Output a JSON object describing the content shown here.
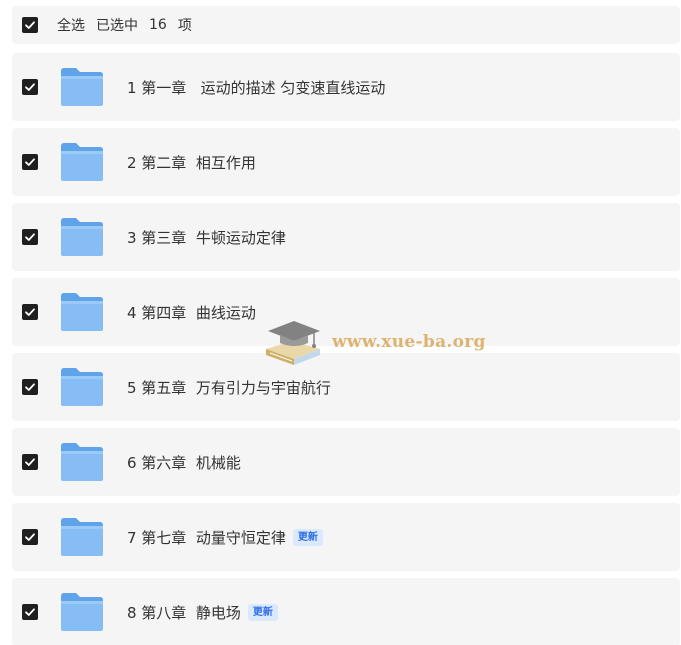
{
  "header": {
    "select_all": "全选",
    "selected_prefix": "已选中",
    "selected_count": "16",
    "selected_suffix": "项"
  },
  "rows": [
    {
      "label": "1 第一章   运动的描述 匀变速直线运动",
      "badge": ""
    },
    {
      "label": "2 第二章  相互作用",
      "badge": ""
    },
    {
      "label": "3 第三章  牛顿运动定律",
      "badge": ""
    },
    {
      "label": "4 第四章  曲线运动",
      "badge": ""
    },
    {
      "label": "5 第五章  万有引力与宇宙航行",
      "badge": ""
    },
    {
      "label": "6 第六章  机械能",
      "badge": ""
    },
    {
      "label": "7 第七章  动量守恒定律",
      "badge": "更新"
    },
    {
      "label": "8 第八章  静电场",
      "badge": "更新"
    }
  ],
  "watermark": {
    "text": "www.xue-ba.org"
  },
  "colors": {
    "row_bg": "#f5f5f6",
    "checkbox": "#1f1f1f",
    "folder_blue": "#7cb6f2",
    "badge_bg": "#dbe9ff",
    "badge_text": "#2f6fe4"
  },
  "icons": {
    "checkbox": "checkbox-checked-icon",
    "folder": "folder-icon",
    "watermark_logo": "graduation-cap-books-icon"
  }
}
